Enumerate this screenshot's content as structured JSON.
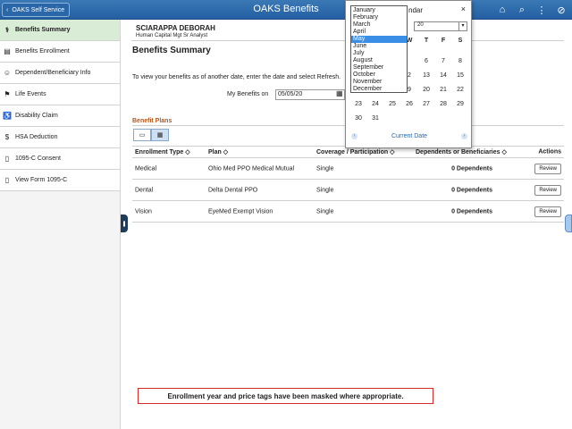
{
  "header": {
    "back_label": "OAKS Self Service",
    "title": "OAKS Benefits",
    "icons": [
      "home-icon",
      "search-icon",
      "menu-icon",
      "block-icon"
    ]
  },
  "sidebar": {
    "items": [
      {
        "label": "Benefits Summary",
        "icon": "benefits-icon",
        "active": true
      },
      {
        "label": "Benefits Enrollment",
        "icon": "enrollment-icon"
      },
      {
        "label": "Dependent/Beneficiary Info",
        "icon": "dependent-icon"
      },
      {
        "label": "Life Events",
        "icon": "life-events-icon"
      },
      {
        "label": "Disability Claim",
        "icon": "disability-icon"
      },
      {
        "label": "HSA Deduction",
        "icon": "hsa-icon"
      },
      {
        "label": "1095-C Consent",
        "icon": "document-icon"
      },
      {
        "label": "View Form 1095-C",
        "icon": "document-icon"
      }
    ]
  },
  "employee": {
    "name": "SCIARAPPA DEBORAH",
    "title": "Human Capital Mgt Sr Analyst"
  },
  "page": {
    "title": "Benefits Summary",
    "instructions": "To view your benefits as of another date, enter the date and select Refresh.",
    "my_benefits_label": "My Benefits on",
    "my_benefits_value": "05/05/20"
  },
  "plans": {
    "title": "Benefit Plans",
    "columns": [
      "Enrollment Type ◇",
      "Plan ◇",
      "Coverage / Participation ◇",
      "Dependents or Beneficiaries ◇",
      "Actions"
    ],
    "rows": [
      {
        "type": "Medical",
        "plan": "Ohio Med PPO Medical Mutual",
        "coverage": "Single",
        "dependents": "0 Dependents",
        "action": "Review"
      },
      {
        "type": "Dental",
        "plan": "Delta Dental PPO",
        "coverage": "Single",
        "dependents": "0 Dependents",
        "action": "Review"
      },
      {
        "type": "Vision",
        "plan": "EyeMed Exempt Vision",
        "coverage": "Single",
        "dependents": "0 Dependents",
        "action": "Review"
      }
    ]
  },
  "note": "Enrollment year and price tags have been masked where appropriate.",
  "calendar": {
    "title": "ndar",
    "year_value": "20",
    "dow": [
      "W",
      "T",
      "F",
      "S"
    ],
    "rows": [
      [
        "",
        "",
        "",
        "",
        "",
        "",
        ""
      ],
      [
        "",
        "",
        "",
        "",
        "6",
        "7",
        "8"
      ],
      [
        "",
        "",
        "",
        "2",
        "13",
        "14",
        "15"
      ],
      [
        "",
        "",
        "",
        "9",
        "20",
        "21",
        "22"
      ],
      [
        "23",
        "24",
        "25",
        "26",
        "27",
        "28",
        "29"
      ],
      [
        "30",
        "31",
        "",
        "",
        "",
        "",
        ""
      ]
    ],
    "current_date_label": "Current Date",
    "months": [
      "January",
      "February",
      "March",
      "April",
      "May",
      "June",
      "July",
      "August",
      "September",
      "October",
      "November",
      "December"
    ],
    "highlighted_month": "May"
  }
}
